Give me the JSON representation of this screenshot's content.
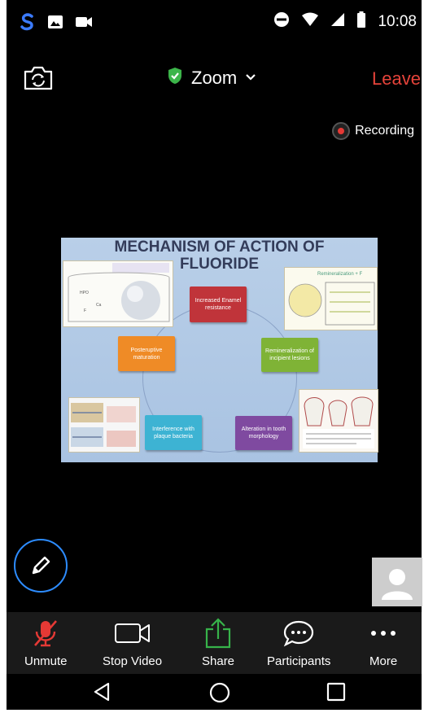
{
  "status_bar": {
    "time": "10:08"
  },
  "header": {
    "title": "Zoom",
    "leave_label": "Leave",
    "recording_label": "Recording"
  },
  "slide": {
    "title_line1": "MECHANISM OF ACTION OF",
    "title_line2": "FLUORIDE",
    "boxes": [
      {
        "text": "Increased Enamel resistance",
        "color": "#c0343a"
      },
      {
        "text": "Remineralization of incipient lesions",
        "color": "#7fb336"
      },
      {
        "text": "Alteration in tooth morphology",
        "color": "#7f4aa0"
      },
      {
        "text": "Interference with plaque bacteria",
        "color": "#3db3d3"
      },
      {
        "text": "Posteruptive maturation",
        "color": "#ef8b26"
      }
    ]
  },
  "toolbar": {
    "unmute": "Unmute",
    "stop_video": "Stop Video",
    "share": "Share",
    "participants": "Participants",
    "more": "More"
  },
  "colors": {
    "leave": "#e5433a",
    "accent": "#2d8cff",
    "share": "#37b34a",
    "muted": "#e53935"
  }
}
